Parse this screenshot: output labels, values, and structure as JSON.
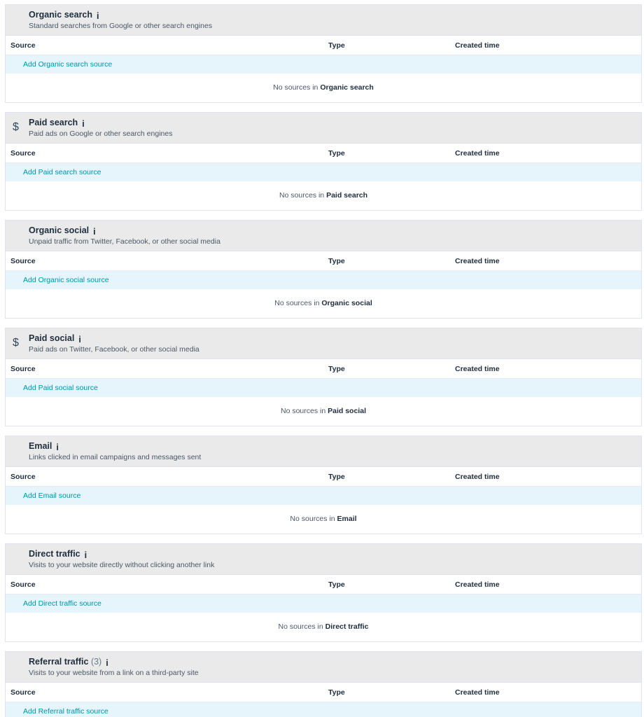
{
  "columns": {
    "source": "Source",
    "type": "Type",
    "created": "Created time"
  },
  "empty_prefix": "No sources in ",
  "colors": {
    "header_bg": "#eaeaea",
    "add_row_bg": "#e5f5fb",
    "link": "#0091ae",
    "info": "#5c62d6",
    "icon": "#2d3e50"
  },
  "sections": [
    {
      "title": "Organic search",
      "count": "",
      "description": "Standard searches from Google or other search engines",
      "add_label": "Add Organic search source",
      "empty_name": "Organic search",
      "icon": "search-chart-icon"
    },
    {
      "title": "Paid search",
      "count": "",
      "description": "Paid ads on Google or other search engines",
      "add_label": "Add Paid search source",
      "empty_name": "Paid search",
      "icon": "search-dollar-icon"
    },
    {
      "title": "Organic social",
      "count": "",
      "description": "Unpaid traffic from Twitter, Facebook, or other social media",
      "add_label": "Add Organic social source",
      "empty_name": "Organic social",
      "icon": "chat-bubbles-icon"
    },
    {
      "title": "Paid social",
      "count": "",
      "description": "Paid ads on Twitter, Facebook, or other social media",
      "add_label": "Add Paid social source",
      "empty_name": "Paid social",
      "icon": "paid-chat-icon"
    },
    {
      "title": "Email",
      "count": "",
      "description": "Links clicked in email campaigns and messages sent",
      "add_label": "Add Email source",
      "empty_name": "Email",
      "icon": "email-inbox-icon"
    },
    {
      "title": "Direct traffic",
      "count": "",
      "description": "Visits to your website directly without clicking another link",
      "add_label": "Add Direct traffic source",
      "empty_name": "Direct traffic",
      "icon": "compass-icon"
    },
    {
      "title": "Referral traffic",
      "count": "(3)",
      "description": "Visits to your website from a link on a third-party site",
      "add_label": "Add Referral traffic source",
      "empty_name": "",
      "icon": "browser-window-icon"
    }
  ]
}
